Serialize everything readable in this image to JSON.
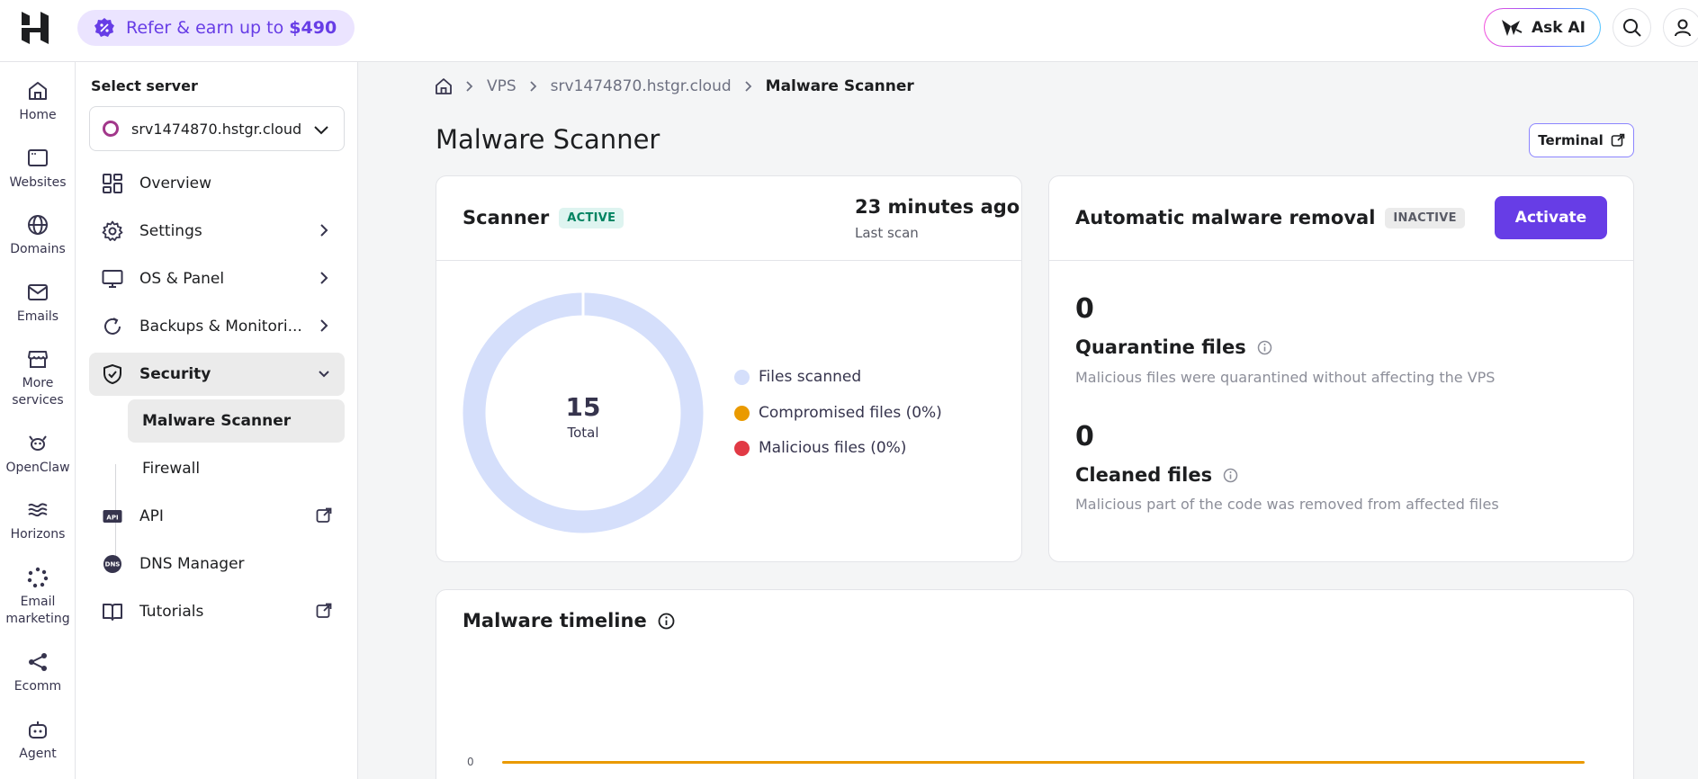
{
  "topbar": {
    "refer_text": "Refer & earn up to ",
    "refer_amount": "$490",
    "ask_ai_label": "Ask AI"
  },
  "rail": [
    {
      "label": "Home",
      "icon": "home-icon"
    },
    {
      "label": "Websites",
      "icon": "websites-icon"
    },
    {
      "label": "Domains",
      "icon": "globe-icon"
    },
    {
      "label": "Emails",
      "icon": "mail-icon"
    },
    {
      "label": "More services",
      "icon": "store-icon"
    },
    {
      "label": "OpenClaw",
      "icon": "openclaw-icon"
    },
    {
      "label": "Horizons",
      "icon": "horizons-icon"
    },
    {
      "label": "Email marketing",
      "icon": "email-marketing-icon"
    },
    {
      "label": "Ecomm",
      "icon": "ecomm-icon"
    },
    {
      "label": "Agent",
      "icon": "agent-icon"
    }
  ],
  "sidebar": {
    "select_label": "Select server",
    "server_value": "srv1474870.hstgr.cloud",
    "items": [
      {
        "label": "Overview",
        "icon": "overview-icon"
      },
      {
        "label": "Settings",
        "icon": "gear-icon"
      },
      {
        "label": "OS & Panel",
        "icon": "monitor-icon"
      },
      {
        "label": "Backups & Monitori...",
        "icon": "refresh-icon"
      },
      {
        "label": "Security",
        "icon": "shield-icon"
      },
      {
        "label": "API",
        "icon": "api-icon"
      },
      {
        "label": "DNS Manager",
        "icon": "dns-icon"
      },
      {
        "label": "Tutorials",
        "icon": "book-icon"
      }
    ],
    "sub_items": [
      {
        "label": "Malware Scanner"
      },
      {
        "label": "Firewall"
      }
    ]
  },
  "breadcrumb": {
    "items": [
      "VPS",
      "srv1474870.hstgr.cloud"
    ],
    "current": "Malware Scanner"
  },
  "page_title": "Malware Scanner",
  "terminal_label": "Terminal",
  "scanner_card": {
    "title": "Scanner",
    "status": "ACTIVE",
    "last_scan_value": "23 minutes ago",
    "last_scan_label": "Last scan",
    "total_value": "15",
    "total_label": "Total",
    "legend": [
      {
        "label": "Files scanned",
        "color": "#d5dffb"
      },
      {
        "label": "Compromised files (0%)",
        "color": "#ea9a00"
      },
      {
        "label": "Malicious files (0%)",
        "color": "#e13a45"
      }
    ],
    "donut": {
      "scanned": 15,
      "compromised": 0,
      "malicious": 0
    }
  },
  "removal_card": {
    "title": "Automatic malware removal",
    "status": "INACTIVE",
    "activate_label": "Activate",
    "quarantine_value": "0",
    "quarantine_title": "Quarantine files",
    "quarantine_desc": "Malicious files were quarantined without affecting the VPS",
    "cleaned_value": "0",
    "cleaned_title": "Cleaned files",
    "cleaned_desc": "Malicious part of the code was removed from affected files"
  },
  "timeline": {
    "title": "Malware timeline",
    "y_tick": "0",
    "line_color": "#ea9a00"
  }
}
